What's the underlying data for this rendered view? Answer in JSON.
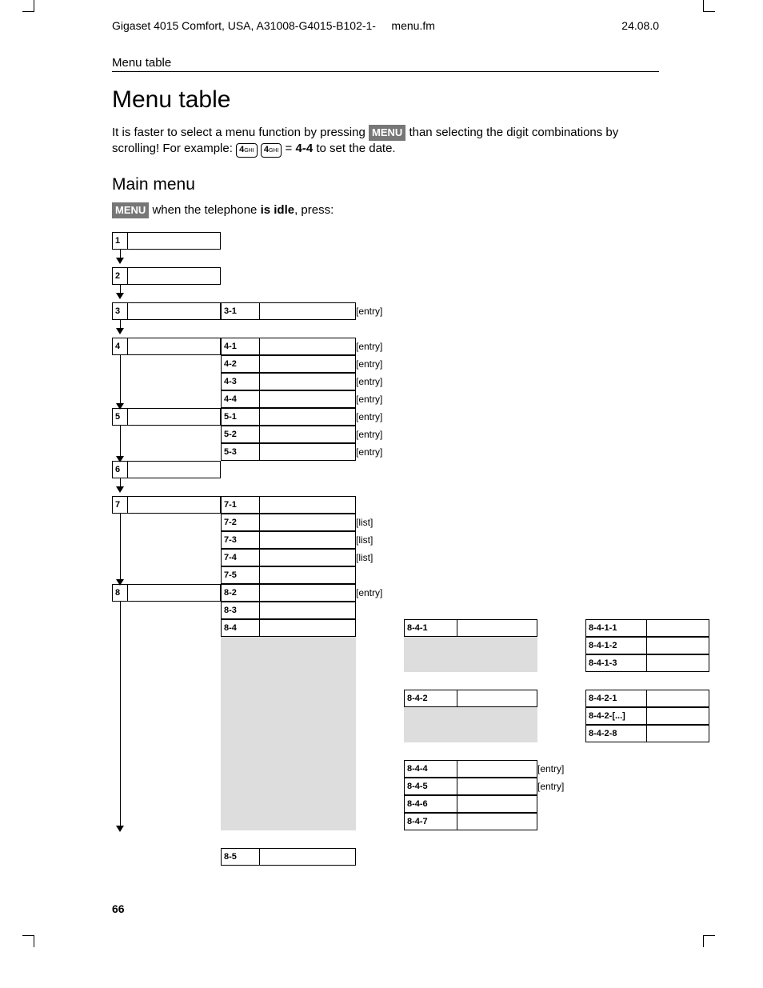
{
  "header": {
    "doc": "Gigaset 4015 Comfort, USA, A31008-G4015-B102-1-",
    "file": "menu.fm",
    "date": "24.08.0"
  },
  "section_label": "Menu table",
  "title": "Menu table",
  "intro_pre": "It is faster to select a menu function by pressing ",
  "intro_mid": " than selecting the digit combinations by scrolling! For example: ",
  "intro_key": "4",
  "intro_keysub": "GHI",
  "intro_eq": " = ",
  "intro_bold_combo": "4-4",
  "intro_post": " to set the date.",
  "menu_badge": "MENU",
  "main_menu_heading": "Main menu",
  "idle_pre": " when the telephone ",
  "idle_bold": "is idle",
  "idle_post": ", press:",
  "entry_label": "[entry]",
  "list_label": "[list]",
  "codes": {
    "c1": "1",
    "c2": "2",
    "c3": "3",
    "c4": "4",
    "c5": "5",
    "c6": "6",
    "c7": "7",
    "c8": "8",
    "c31": "3-1",
    "c41": "4-1",
    "c42": "4-2",
    "c43": "4-3",
    "c44": "4-4",
    "c51": "5-1",
    "c52": "5-2",
    "c53": "5-3",
    "c71": "7-1",
    "c72": "7-2",
    "c73": "7-3",
    "c74": "7-4",
    "c75": "7-5",
    "c82": "8-2",
    "c83": "8-3",
    "c84": "8-4",
    "c85": "8-5",
    "c841": "8-4-1",
    "c842": "8-4-2",
    "c844": "8-4-4",
    "c845": "8-4-5",
    "c846": "8-4-6",
    "c847": "8-4-7",
    "c8411": "8-4-1-1",
    "c8412": "8-4-1-2",
    "c8413": "8-4-1-3",
    "c8421": "8-4-2-1",
    "c842x": "8-4-2-[...]",
    "c8428": "8-4-2-8"
  },
  "page_number": "66"
}
